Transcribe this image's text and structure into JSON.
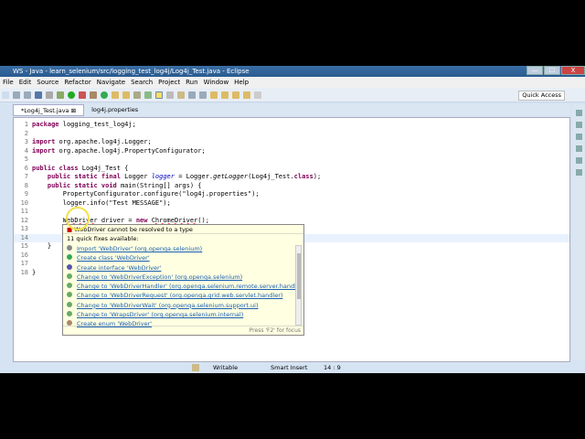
{
  "window": {
    "title": "WS - Java - learn_selenium/src/logging_test_log4j/Log4j_Test.java - Eclipse",
    "minimize": "—",
    "maximize": "☐",
    "close": "X"
  },
  "menu": [
    "File",
    "Edit",
    "Source",
    "Refactor",
    "Navigate",
    "Search",
    "Project",
    "Run",
    "Window",
    "Help"
  ],
  "toolbar": {
    "quick_access": "Quick Access"
  },
  "tabs": [
    {
      "label": "*Log4j_Test.java",
      "close": "⊠",
      "active": true
    },
    {
      "label": "log4j.properties",
      "active": false
    }
  ],
  "code": [
    {
      "n": "1",
      "t": "package logging_test_log4j;"
    },
    {
      "n": "2",
      "t": ""
    },
    {
      "n": "3",
      "t": "import org.apache.log4j.Logger;"
    },
    {
      "n": "4",
      "t": "import org.apache.log4j.PropertyConfigurator;"
    },
    {
      "n": "5",
      "t": ""
    },
    {
      "n": "6",
      "t": "public class Log4j_Test {"
    },
    {
      "n": "7",
      "t": "    public static final Logger logger = Logger.getLogger(Log4j_Test.class);"
    },
    {
      "n": "8",
      "t": "    public static void main(String[] args) {"
    },
    {
      "n": "9",
      "t": "        PropertyConfigurator.configure(\"log4j.properties\");"
    },
    {
      "n": "10",
      "t": "        logger.info(\"Test MESSAGE\");"
    },
    {
      "n": "11",
      "t": ""
    },
    {
      "n": "12",
      "t": "        WebDriver driver = new ChromeDriver();"
    },
    {
      "n": "13",
      "t": ""
    },
    {
      "n": "14",
      "t": ""
    },
    {
      "n": "15",
      "t": "    }"
    },
    {
      "n": "16",
      "t": ""
    },
    {
      "n": "17",
      "t": ""
    },
    {
      "n": "18",
      "t": "}"
    }
  ],
  "quickfix": {
    "error": "WebDriver cannot be resolved to a type",
    "count": "11 quick fixes available:",
    "items": [
      "Import 'WebDriver' (org.openqa.selenium)",
      "Create class 'WebDriver'",
      "Create interface 'WebDriver'",
      "Change to 'WebDriverException' (org.openqa.selenium)",
      "Change to 'WebDriverHandler' (org.openqa.selenium.remote.server.handler)",
      "Change to 'WebDriverRequest' (org.openqa.grid.web.servlet.handler)",
      "Change to 'WebDriverWait' (org.openqa.selenium.support.ui)",
      "Change to 'WrapsDriver' (org.openqa.selenium.internal)",
      "Create enum 'WebDriver'"
    ],
    "footer": "Press 'F2' for focus"
  },
  "status": {
    "mode": "Writable",
    "insert": "Smart Insert",
    "position": "14 : 9"
  }
}
